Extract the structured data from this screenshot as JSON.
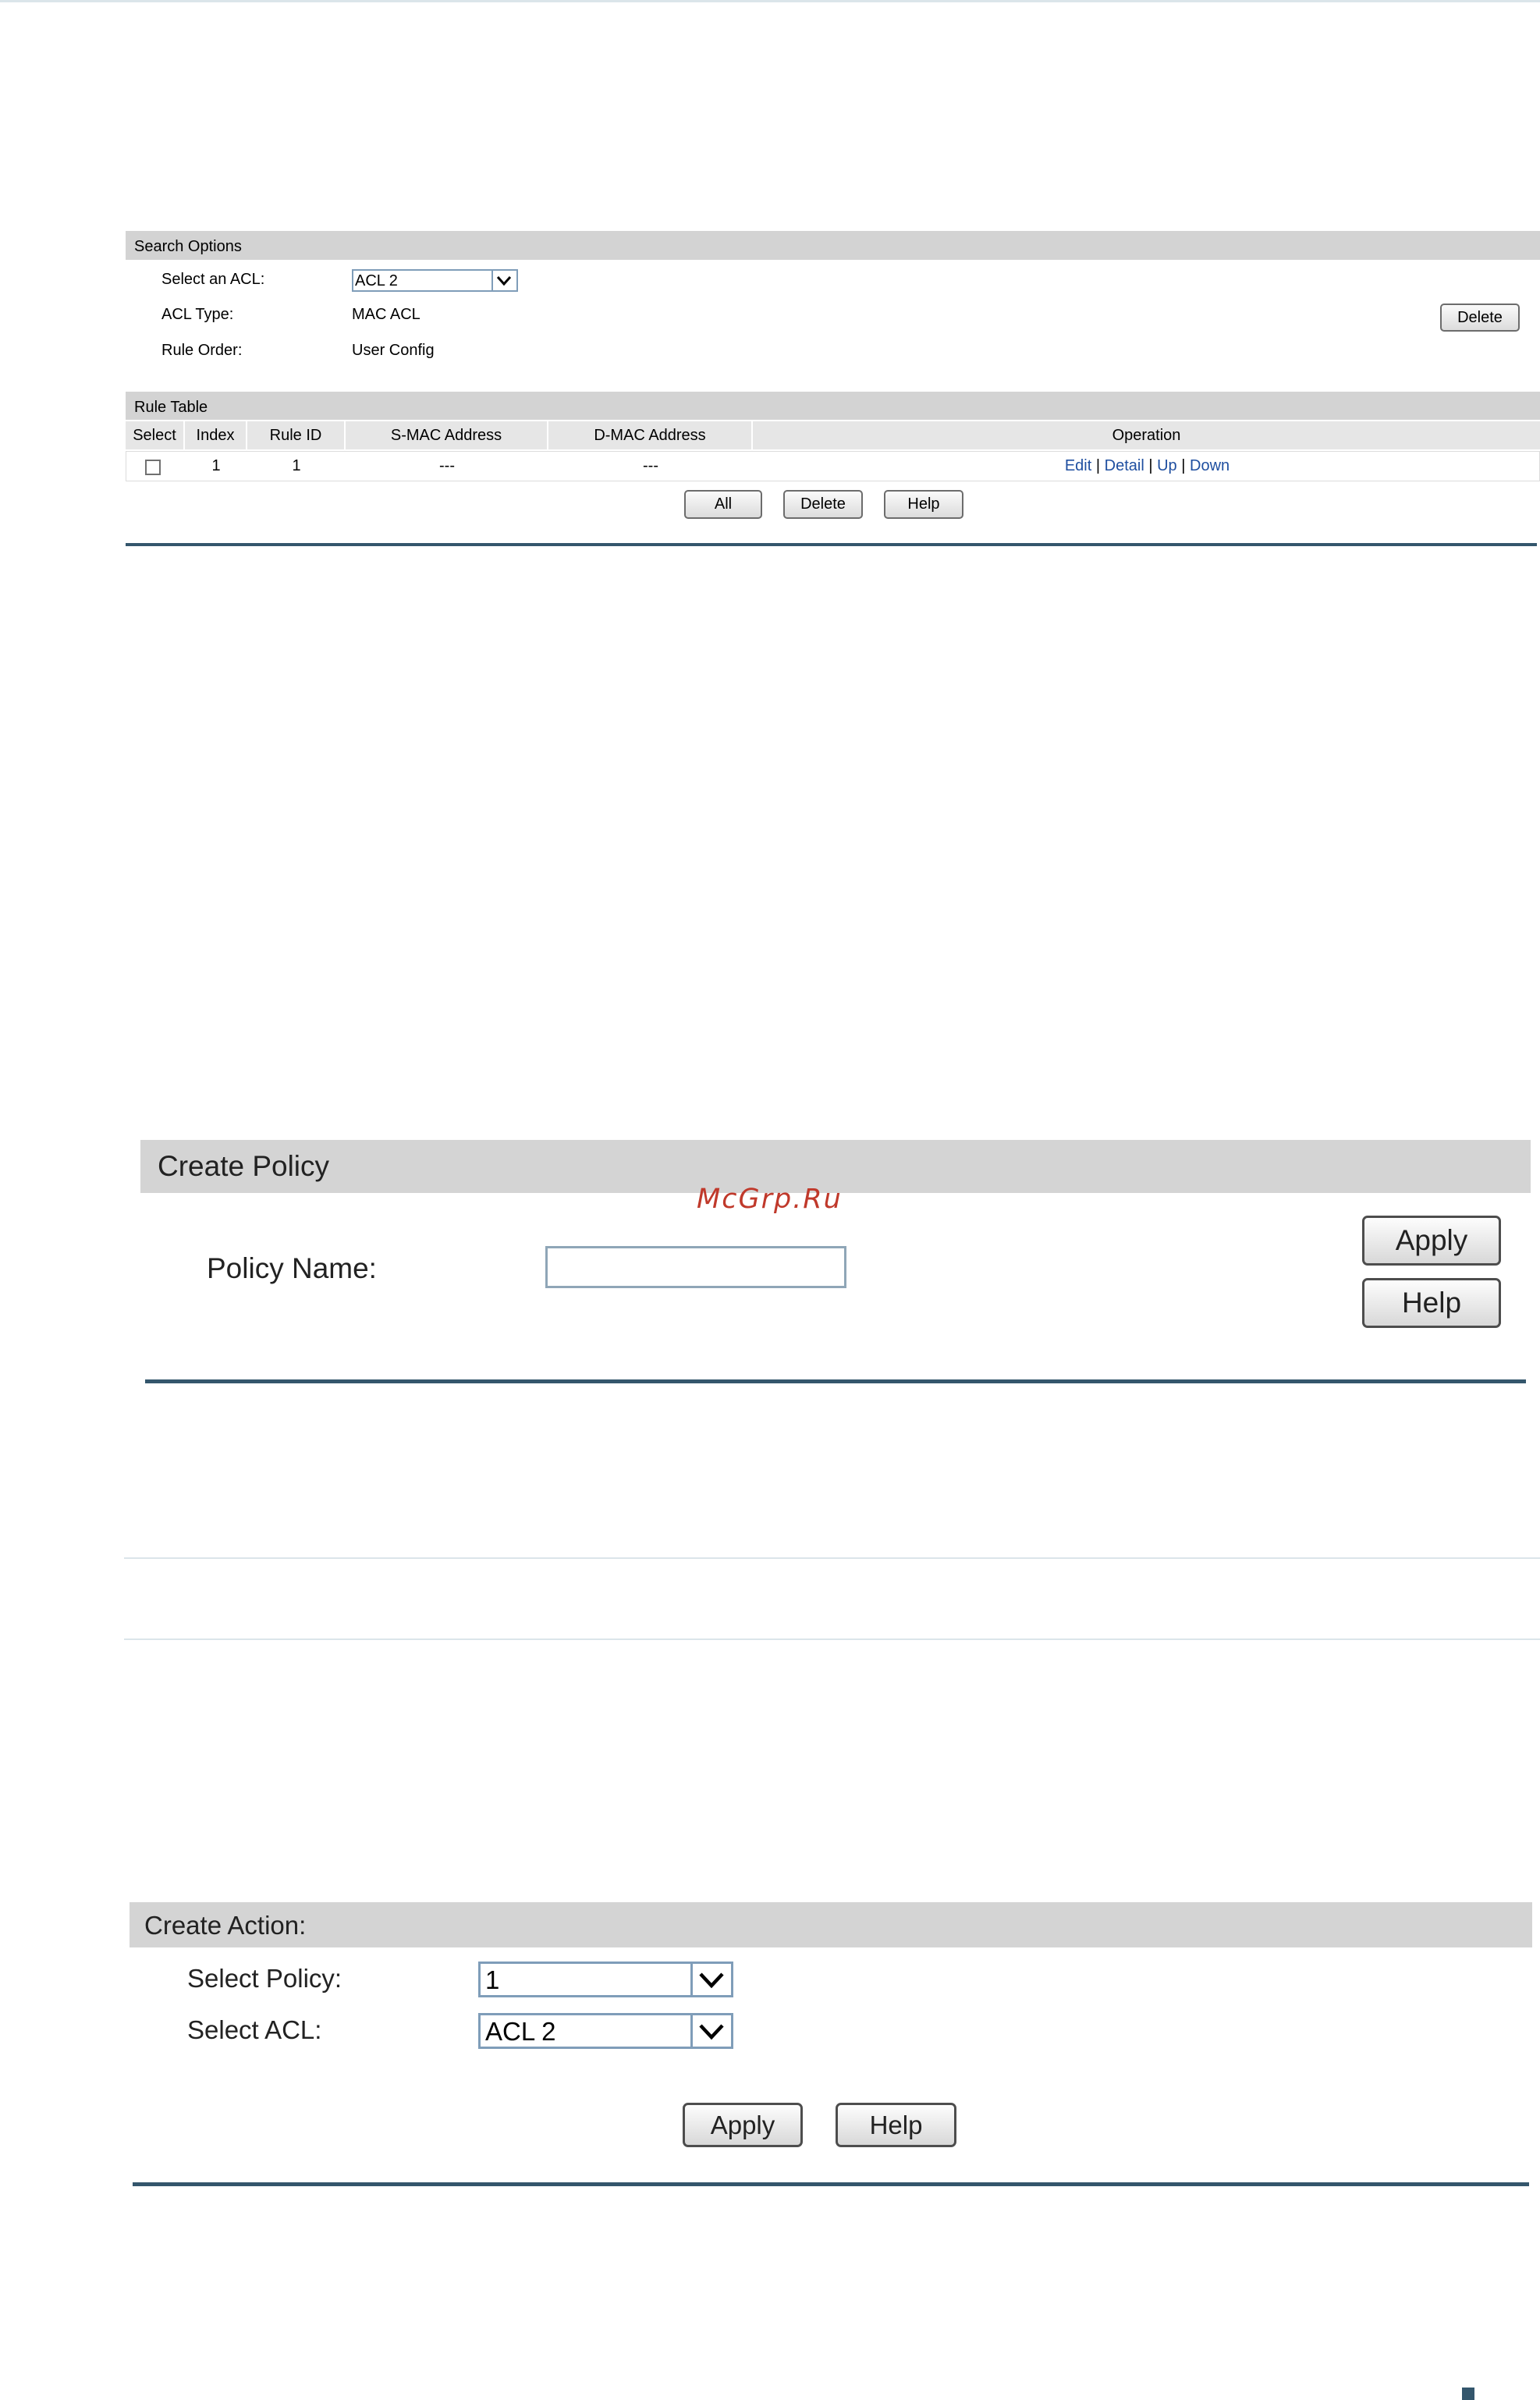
{
  "acl_panel": {
    "search_options_title": "Search Options",
    "select_acl_label": "Select an ACL:",
    "select_acl_value": "ACL 2",
    "acl_type_label": "ACL Type:",
    "acl_type_value": "MAC ACL",
    "rule_order_label": "Rule Order:",
    "rule_order_value": "User Config",
    "delete_label": "Delete",
    "rule_table_title": "Rule Table",
    "columns": [
      "Select",
      "Index",
      "Rule ID",
      "S-MAC Address",
      "D-MAC Address",
      "Operation"
    ],
    "rows": [
      {
        "index": "1",
        "rule_id": "1",
        "smac": "---",
        "dmac": "---",
        "selected": false
      }
    ],
    "operations": {
      "edit": "Edit",
      "detail": "Detail",
      "up": "Up",
      "down": "Down",
      "separator": "|"
    },
    "buttons": {
      "all": "All",
      "delete": "Delete",
      "help": "Help"
    }
  },
  "policy_panel": {
    "title": "Create Policy",
    "policy_name_label": "Policy Name:",
    "policy_name_value": "",
    "apply": "Apply",
    "help": "Help"
  },
  "watermark": "McGrp.Ru",
  "action_panel": {
    "title": "Create Action:",
    "select_policy_label": "Select Policy:",
    "select_policy_value": "1",
    "select_acl_label": "Select ACL:",
    "select_acl_value": "ACL 2",
    "apply": "Apply",
    "help": "Help"
  },
  "colors": {
    "header_bg": "#d3d3d3",
    "link": "#1f4fa0",
    "divider": "#34566c",
    "watermark": "#c0392b"
  }
}
